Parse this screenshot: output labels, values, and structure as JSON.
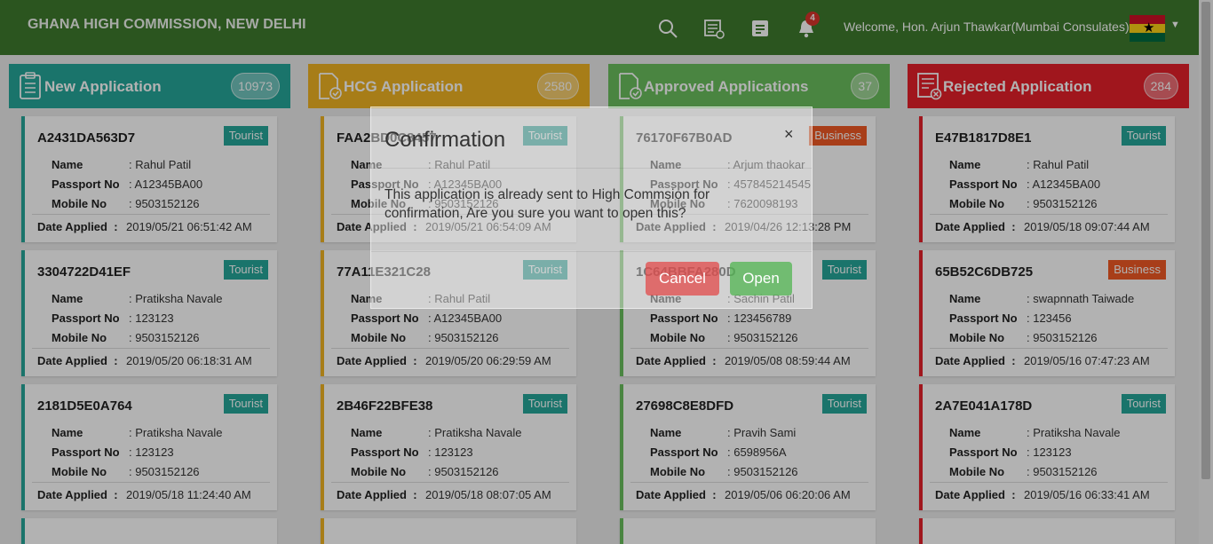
{
  "header": {
    "title": "GHANA HIGH COMMISSION, NEW DELHI",
    "notification_count": "4",
    "welcome": "Welcome, Hon. Arjun Thawkar(Mumbai Consulates)",
    "icons": [
      "search-icon",
      "report-icon",
      "notes-icon",
      "bell-icon",
      "ghana-flag",
      "chevron-down-icon"
    ]
  },
  "columns": [
    {
      "title": "New Application",
      "count": "10973",
      "color": "#26a69a",
      "cards": [
        {
          "id": "A2431DA563D7",
          "type": "Tourist",
          "name": ": Rahul Patil",
          "passport": ": A12345BA00",
          "mobile": ": 9503152126",
          "date": "2019/05/21 06:51:42 AM"
        },
        {
          "id": "3304722D41EF",
          "type": "Tourist",
          "name": ": Pratiksha Navale",
          "passport": ": 123123",
          "mobile": ": 9503152126",
          "date": "2019/05/20 06:18:31 AM"
        },
        {
          "id": "2181D5E0A764",
          "type": "Tourist",
          "name": ": Pratiksha Navale",
          "passport": ": 123123",
          "mobile": ": 9503152126",
          "date": "2019/05/18 11:24:40 AM"
        }
      ]
    },
    {
      "title": "HCG Application",
      "count": "2580",
      "color": "#f0b323",
      "cards": [
        {
          "id": "FAA2BD0C8457",
          "type": "Tourist",
          "name": ": Rahul Patil",
          "passport": ": A12345BA00",
          "mobile": ": 9503152126",
          "date": "2019/05/21 06:54:09 AM"
        },
        {
          "id": "77A11E321C28",
          "type": "Tourist",
          "name": ": Rahul Patil",
          "passport": ": A12345BA00",
          "mobile": ": 9503152126",
          "date": "2019/05/20 06:29:59 AM"
        },
        {
          "id": "2B46F22BFE38",
          "type": "Tourist",
          "name": ": Pratiksha Navale",
          "passport": ": 123123",
          "mobile": ": 9503152126",
          "date": "2019/05/18 08:07:05 AM"
        }
      ]
    },
    {
      "title": "Approved Applications",
      "count": "37",
      "color": "#6abf5e",
      "cards": [
        {
          "id": "76170F67B0AD",
          "type": "Business",
          "name": ": Arjum thaokar",
          "passport": ": 457845214545",
          "mobile": ": 7620098193",
          "date": "2019/04/26 12:13:28 PM"
        },
        {
          "id": "1C64BBFA280D",
          "type": "Tourist",
          "name": ": Sachin Patil",
          "passport": ": 123456789",
          "mobile": ": 9503152126",
          "date": "2019/05/08 08:59:44 AM"
        },
        {
          "id": "27698C8E8DFD",
          "type": "Tourist",
          "name": ": Pravih Sami",
          "passport": ": 6598956A",
          "mobile": ": 9503152126",
          "date": "2019/05/06 06:20:06 AM"
        }
      ]
    },
    {
      "title": "Rejected Application",
      "count": "284",
      "color": "#e5202a",
      "cards": [
        {
          "id": "E47B1817D8E1",
          "type": "Tourist",
          "name": ": Rahul Patil",
          "passport": ": A12345BA00",
          "mobile": ": 9503152126",
          "date": "2019/05/18 09:07:44 AM"
        },
        {
          "id": "65B52C6DB725",
          "type": "Business",
          "name": ": swapnnath Taiwade",
          "passport": ": 123456",
          "mobile": ": 9503152126",
          "date": "2019/05/16 07:47:23 AM"
        },
        {
          "id": "2A7E041A178D",
          "type": "Tourist",
          "name": ": Pratiksha Navale",
          "passport": ": 123123",
          "mobile": ": 9503152126",
          "date": "2019/05/16 06:33:41 AM"
        }
      ]
    }
  ],
  "labels": {
    "name": "Name",
    "passport": "Passport No",
    "mobile": "Mobile No",
    "date": "Date Applied",
    "date_colon": ":"
  },
  "tag_colors": {
    "Tourist": "#26a69a",
    "Business": "#f15a24"
  },
  "modal": {
    "title": "Confirmation",
    "close": "×",
    "body": "This application is already sent to High Commsion for confirmation, Are you sure you want to open this?",
    "cancel": "Cancel",
    "open": "Open"
  }
}
